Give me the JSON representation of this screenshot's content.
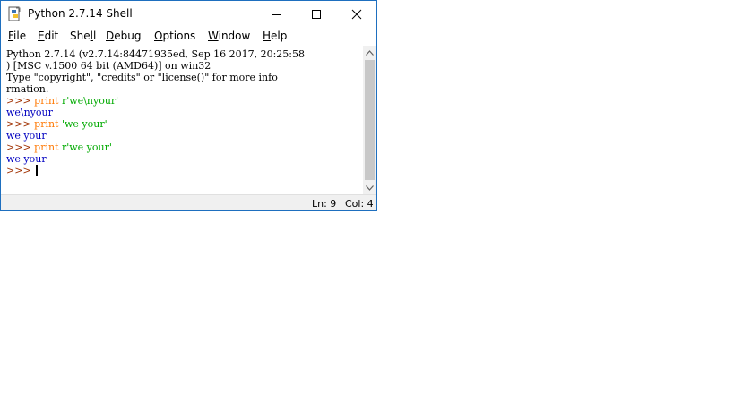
{
  "window": {
    "title": "Python 2.7.14 Shell"
  },
  "menu": {
    "file": {
      "accel": "F",
      "rest": "ile"
    },
    "edit": {
      "accel": "E",
      "rest": "dit"
    },
    "shell": {
      "pre": "She",
      "accel": "l",
      "rest": "l"
    },
    "debug": {
      "accel": "D",
      "rest": "ebug"
    },
    "options": {
      "accel": "O",
      "rest": "ptions"
    },
    "window": {
      "accel": "W",
      "rest": "indow"
    },
    "help": {
      "accel": "H",
      "rest": "elp"
    }
  },
  "shell": {
    "banner_1": "Python 2.7.14 (v2.7.14:84471935ed, Sep 16 2017, 20:25:58",
    "banner_2": ") [MSC v.1500 64 bit (AMD64)] on win32",
    "banner_3": "Type \"copyright\", \"credits\" or \"license()\" for more info",
    "banner_4": "rmation.",
    "prompt": ">>> ",
    "cmd1_keyword": "print",
    "cmd1_string": " r'we\\nyour'",
    "out1": "we\\nyour",
    "cmd2_keyword": "print",
    "cmd2_string": " 'we your'",
    "out2": "we your",
    "cmd3_keyword": "print",
    "cmd3_string": " r'we your'",
    "out3": "we your"
  },
  "status": {
    "line": "Ln: 9",
    "column": "Col: 4"
  },
  "colors": {
    "prompt": "#a03000",
    "keyword": "#ff7700",
    "string": "#00aa00",
    "output": "#0000c0",
    "window_border": "#1e6fbf"
  },
  "icons": {
    "app": "python-idle-icon",
    "minimize": "minimize-icon",
    "maximize": "maximize-icon",
    "close": "close-icon",
    "scroll_up": "chevron-up-icon",
    "scroll_down": "chevron-down-icon"
  }
}
